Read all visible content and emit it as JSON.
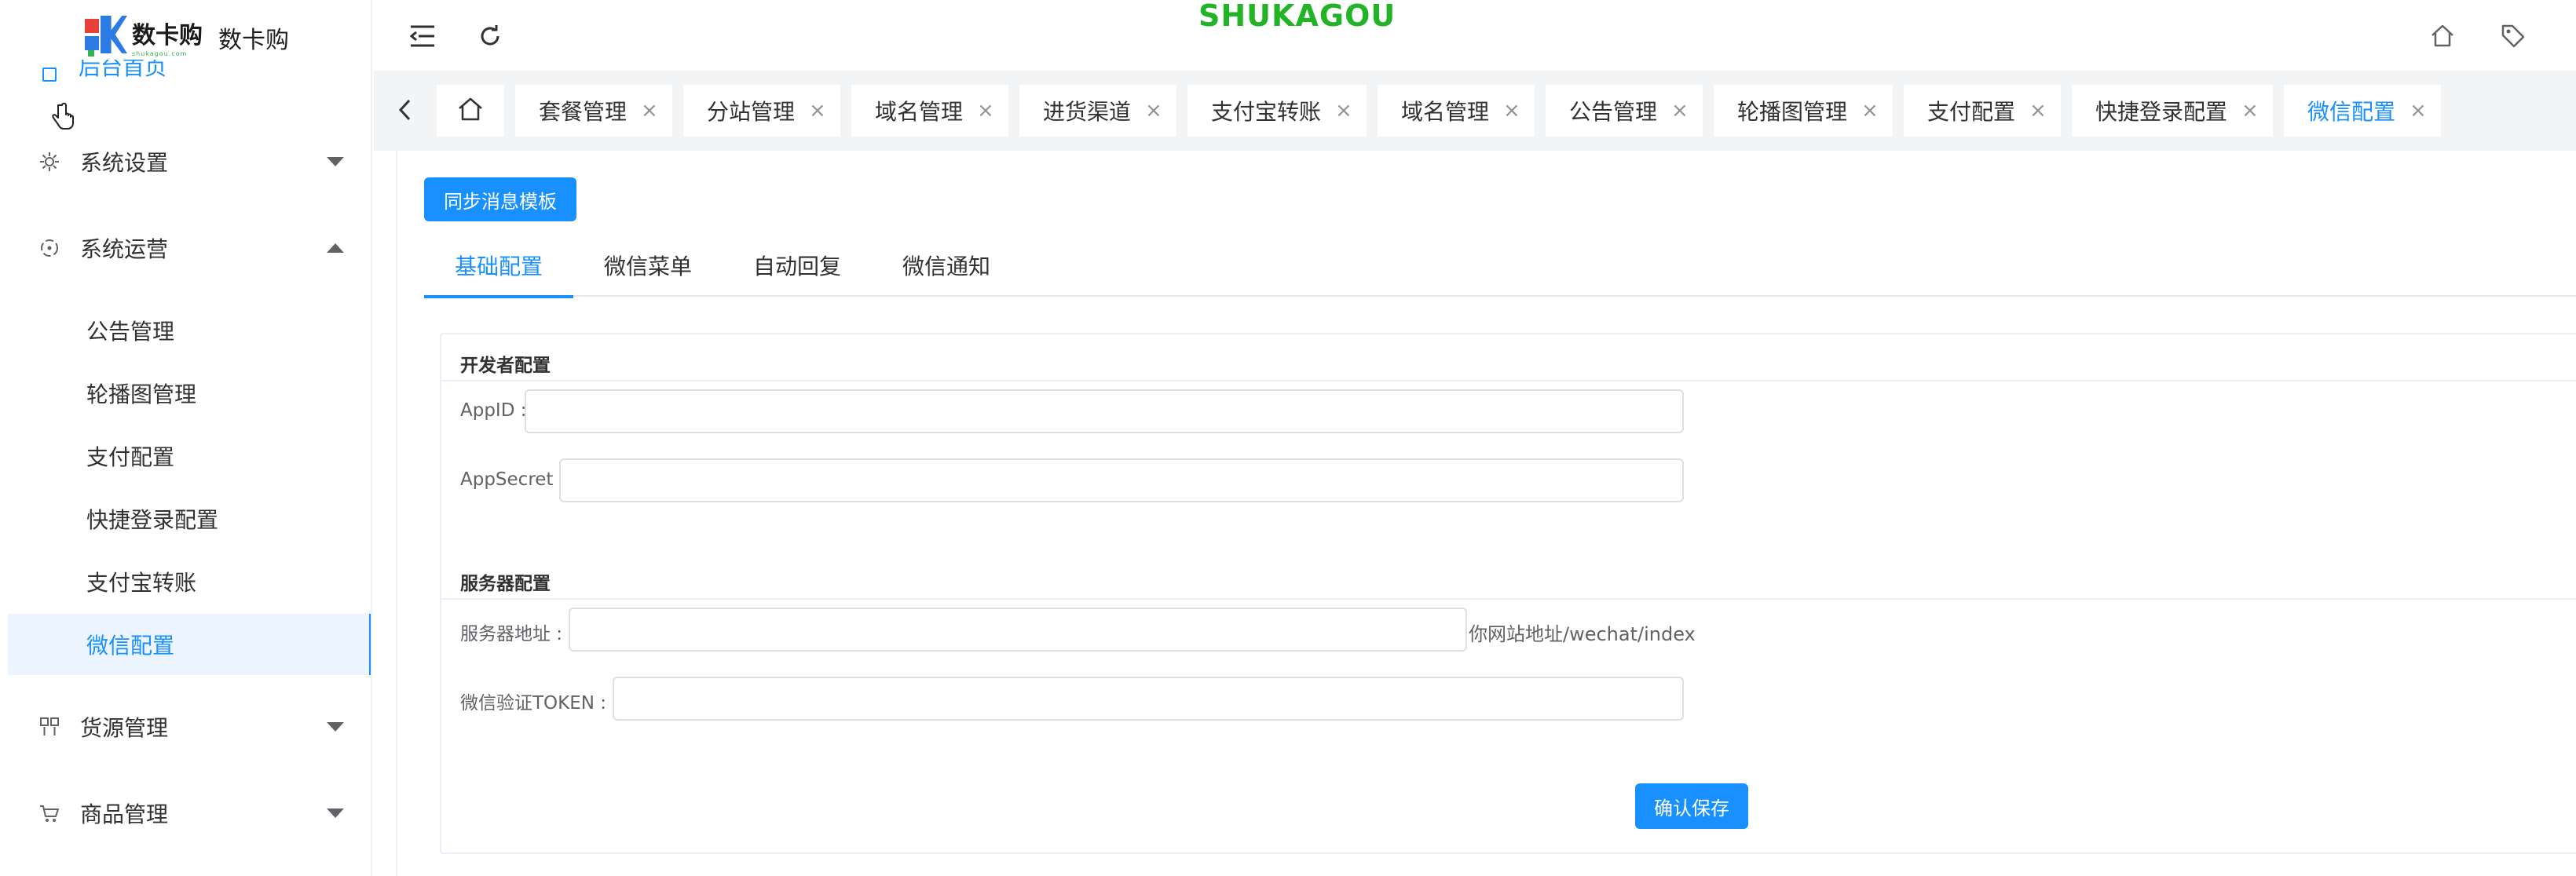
{
  "brand": {
    "logo_text": "数卡购",
    "logo_sub": "shukagou.com",
    "name": "数卡购",
    "wordmark": "SHUKAGOU"
  },
  "sidebar": {
    "partial_item": "后台首页",
    "groups": [
      {
        "label": "系统设置",
        "icon": "gear-icon",
        "state": "collapsed"
      },
      {
        "label": "系统运营",
        "icon": "operations-icon",
        "state": "expanded"
      },
      {
        "label": "货源管理",
        "icon": "grid-icon",
        "state": "collapsed"
      },
      {
        "label": "商品管理",
        "icon": "cart-icon",
        "state": "collapsed"
      }
    ],
    "sub_items": [
      "公告管理",
      "轮播图管理",
      "支付配置",
      "快捷登录配置",
      "支付宝转账",
      "微信配置"
    ],
    "active_sub_item": "微信配置"
  },
  "header": {
    "icons": [
      "menu-fold-icon",
      "refresh-icon",
      "home-icon",
      "tag-icon"
    ]
  },
  "tabs": {
    "items": [
      {
        "label": "套餐管理"
      },
      {
        "label": "分站管理"
      },
      {
        "label": "域名管理"
      },
      {
        "label": "进货渠道"
      },
      {
        "label": "支付宝转账"
      },
      {
        "label": "域名管理"
      },
      {
        "label": "公告管理"
      },
      {
        "label": "轮播图管理"
      },
      {
        "label": "支付配置"
      },
      {
        "label": "快捷登录配置"
      },
      {
        "label": "微信配置"
      }
    ],
    "close_glyph": "×",
    "active": "微信配置"
  },
  "main": {
    "sync_button": "同步消息模板",
    "subtabs": [
      "基础配置",
      "微信菜单",
      "自动回复",
      "微信通知"
    ],
    "active_subtab": "基础配置",
    "developer_section": {
      "title": "开发者配置",
      "appid_label": "AppID :",
      "appid_value": "",
      "appsecret_label": "AppSecret :",
      "appsecret_value": ""
    },
    "server_section": {
      "title": "服务器配置",
      "server_url_label": "服务器地址 :",
      "server_url_value": "",
      "server_url_suffix": "你网站地址/wechat/index",
      "token_label": "微信验证TOKEN :",
      "token_value": ""
    },
    "save_button": "确认保存"
  },
  "colors": {
    "primary": "#1890ff",
    "wordmark": "#22b327",
    "tabs_bg": "#f3f4f6",
    "active_bg": "#ecf5ff"
  }
}
